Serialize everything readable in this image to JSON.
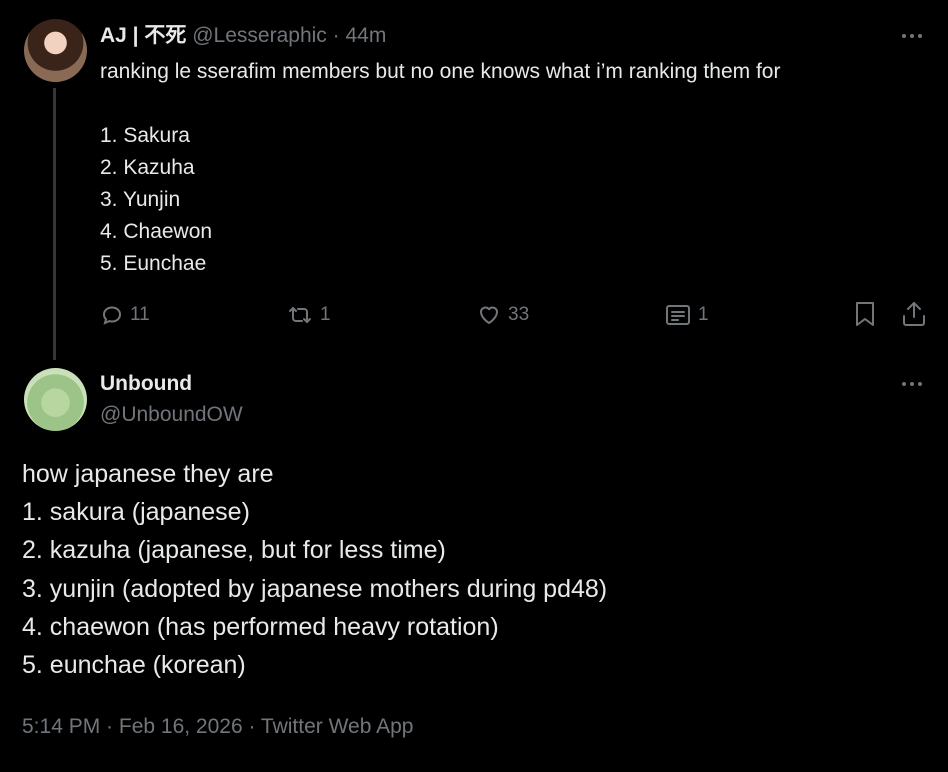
{
  "tweet1": {
    "display_name": "AJ | 不死",
    "handle": "@Lesseraphic",
    "separator": "·",
    "time": "44m",
    "lines": [
      "ranking le sserafim members but no one knows what i’m ranking them for",
      "",
      "1. Sakura",
      "2. Kazuha",
      "3. Yunjin",
      "4. Chaewon",
      "5. Eunchae"
    ],
    "actions": {
      "replies": "11",
      "retweets": "1",
      "likes": "33",
      "views": "1"
    }
  },
  "tweet2": {
    "display_name": "Unbound",
    "handle": "@UnboundOW",
    "lines": [
      "how japanese they are",
      "1. sakura (japanese)",
      "2. kazuha (japanese, but for less time)",
      "3. yunjin (adopted by japanese mothers during pd48)",
      "4. chaewon (has performed heavy rotation)",
      "5. eunchae (korean)"
    ],
    "meta": "5:14 PM · Feb 16, 2026 · Twitter Web App"
  },
  "colors": {
    "background": "#000000",
    "text": "#e7e9ea",
    "muted": "#71767b",
    "thread_line": "#333639"
  }
}
